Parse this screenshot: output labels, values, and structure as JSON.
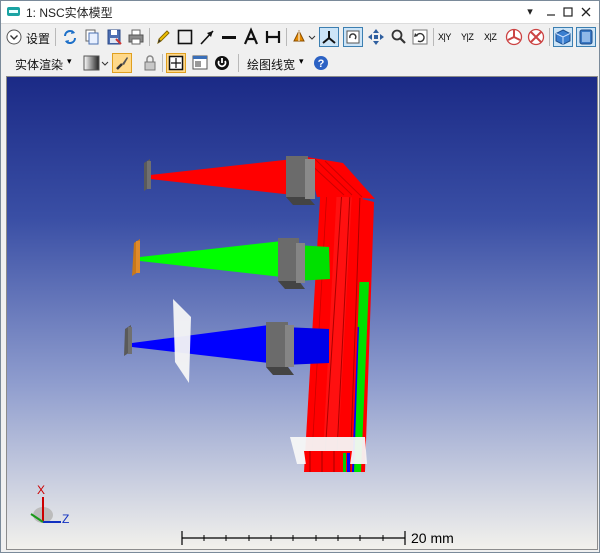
{
  "window": {
    "title": "1: NSC实体模型"
  },
  "toolbar1": {
    "settings_label": "设置",
    "xy_label": "X|Y",
    "yz_label": "Y|Z",
    "xz_label": "X|Z"
  },
  "toolbar2": {
    "render_label": "实体渲染",
    "linewidth_label": "绘图线宽"
  },
  "viewport": {
    "scale_label": "20 mm",
    "axis_x": "X",
    "axis_z": "Z",
    "background_top": "#1b2a86",
    "background_bottom": "#f2f1ec",
    "beam_colors": {
      "red": "#ff0000",
      "green": "#00ee00",
      "blue": "#0000ff"
    }
  }
}
